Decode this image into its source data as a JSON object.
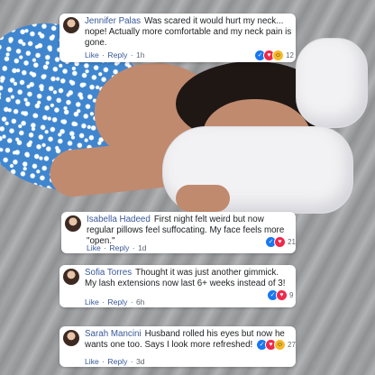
{
  "colors": {
    "author_link": "#385898",
    "like_blue": "#1877f2",
    "love_red": "#f0284a",
    "haha_yellow": "#f7b928",
    "dress_blue": "#3f86cf"
  },
  "comments": [
    {
      "author": "Jennifer Palas",
      "text": "Was scared it would hurt my neck... nope! Actually more comfortable and my neck pain is gone.",
      "like_label": "Like",
      "reply_label": "Reply",
      "time": "1h",
      "reaction_count": "12",
      "reactions": [
        "like-icon",
        "love-icon",
        "haha-icon"
      ]
    },
    {
      "author": "Isabella Hadeed",
      "text": "First night felt weird but now regular pillows feel suffocating. My face feels more \"open.\"",
      "like_label": "Like",
      "reply_label": "Reply",
      "time": "1d",
      "reaction_count": "21",
      "reactions": [
        "like-icon",
        "love-icon"
      ]
    },
    {
      "author": "Sofia Torres",
      "text": "Thought it was just another gimmick. My lash extensions now last 6+ weeks instead of 3!",
      "like_label": "Like",
      "reply_label": "Reply",
      "time": "6h",
      "reaction_count": "9",
      "reactions": [
        "like-icon",
        "love-icon"
      ]
    },
    {
      "author": "Sarah Mancini",
      "text": "Husband rolled his eyes but now he wants one too. Says I look more refreshed!",
      "like_label": "Like",
      "reply_label": "Reply",
      "time": "3d",
      "reaction_count": "27",
      "reactions": [
        "like-icon",
        "love-icon",
        "haha-icon"
      ]
    }
  ]
}
